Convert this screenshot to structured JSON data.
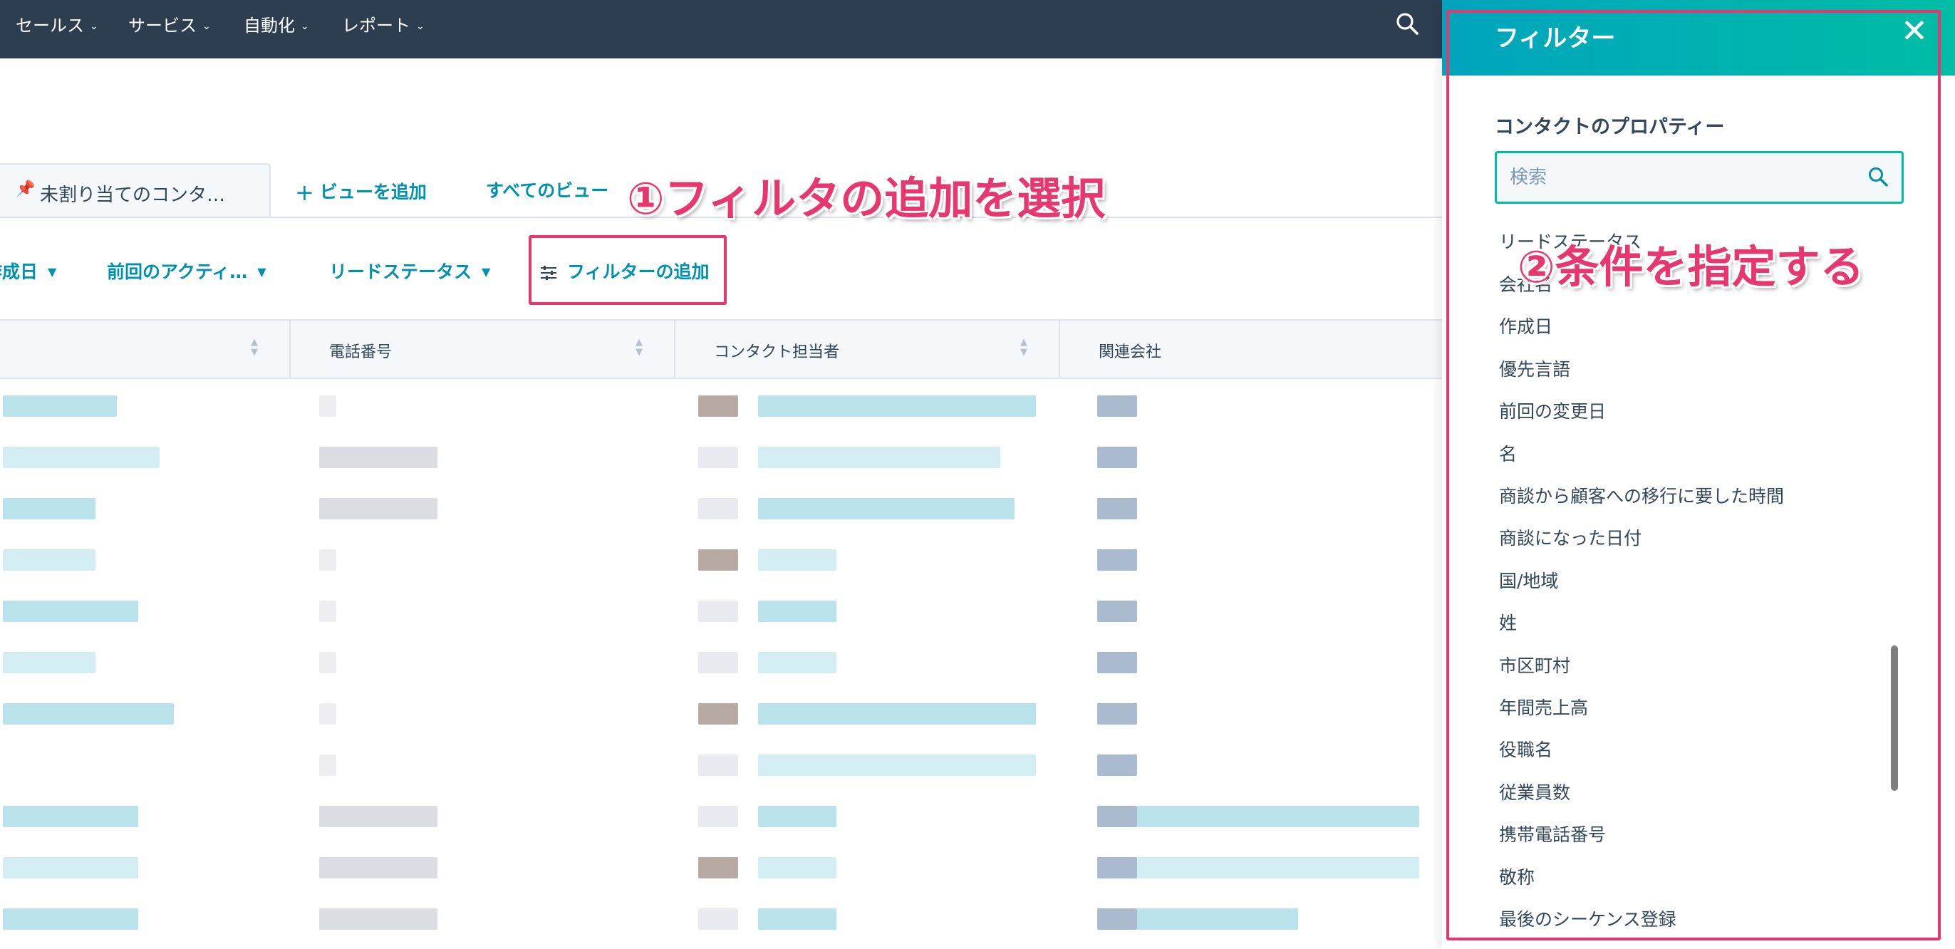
{
  "nav": {
    "items": [
      {
        "label": "セールス"
      },
      {
        "label": "サービス"
      },
      {
        "label": "自動化"
      },
      {
        "label": "レポート"
      }
    ]
  },
  "views": {
    "current_tab": "未割り当てのコンタ…",
    "add_view": "ビューを追加",
    "all_views": "すべてのビュー"
  },
  "filters": {
    "chips": [
      "作成日",
      "前回のアクティ…",
      "リードステータス"
    ],
    "add_filter": "フィルターの追加"
  },
  "table": {
    "columns": [
      "",
      "電話番号",
      "コンタクト担当者",
      "関連会社"
    ]
  },
  "panel": {
    "title": "フィルター",
    "section_label": "コンタクトのプロパティー",
    "search_placeholder": "検索",
    "properties": [
      "リードステータス",
      "会社名",
      "作成日",
      "優先言語",
      "前回の変更日",
      "名",
      "商談から顧客への移行に要した時間",
      "商談になった日付",
      "国/地域",
      "姓",
      "市区町村",
      "年間売上高",
      "役職名",
      "従業員数",
      "携帯電話番号",
      "敬称",
      "最後のシーケンス登録"
    ]
  },
  "annotations": {
    "step1": "①フィルタの追加を選択",
    "step2": "②条件を指定する"
  },
  "colors": {
    "nav_bg": "#2d3e50",
    "link": "#0091ae",
    "panel_header_start": "#00a4bd",
    "panel_header_end": "#00bda5",
    "annotation": "#e8366f"
  }
}
